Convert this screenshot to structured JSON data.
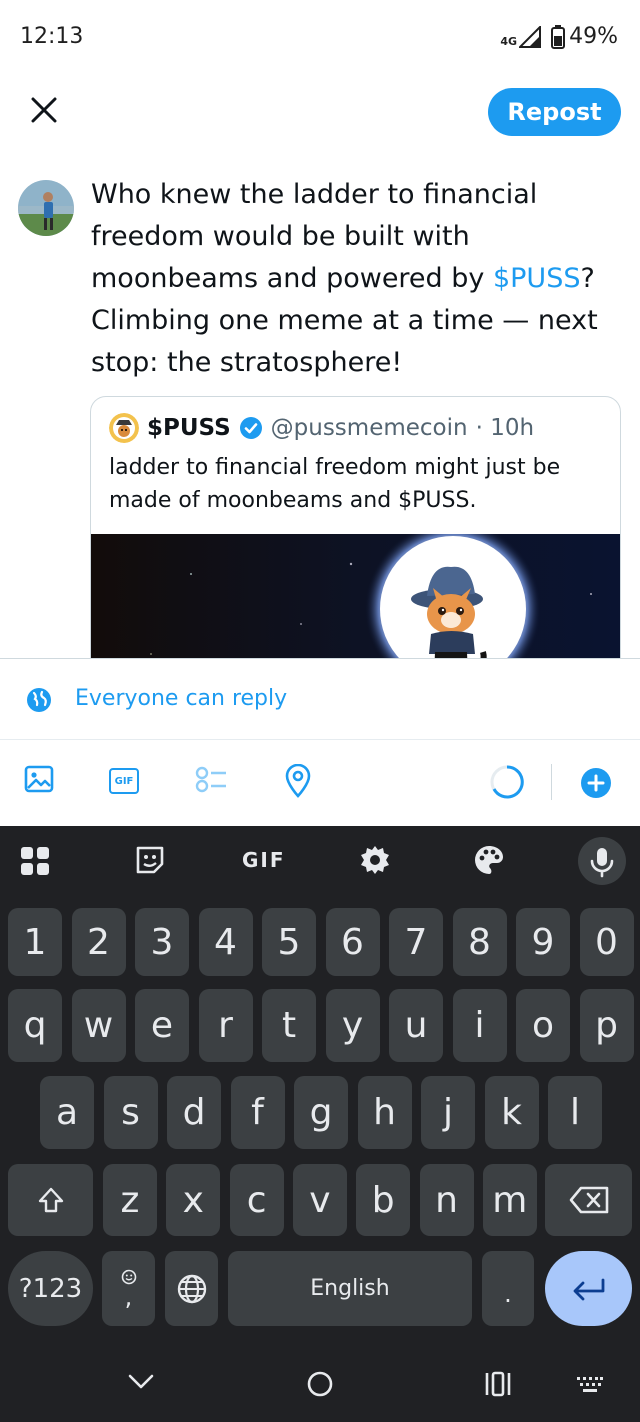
{
  "status_bar": {
    "time": "12:13",
    "network": "4G",
    "battery": "49%"
  },
  "header": {
    "close_icon": "close-icon",
    "repost_label": "Repost"
  },
  "compose": {
    "text_before": "Who knew the ladder to financial freedom would be built with moonbeams and powered by ",
    "cashtag": "$PUSS",
    "text_after": "? Climbing one meme at a time — next stop: the stratosphere!"
  },
  "quote": {
    "name": "$PUSS",
    "handle": "@pussmemecoin",
    "time": "· 10h",
    "text": "ladder to financial freedom might just be made of moonbeams and $PUSS."
  },
  "reply_setting": {
    "label": "Everyone can reply"
  },
  "toolbar": {
    "icons": [
      "image-icon",
      "gif-icon",
      "poll-icon",
      "location-icon",
      "char-count-ring",
      "add-thread-icon"
    ],
    "gif_label": "GIF"
  },
  "keyboard": {
    "top_icons": [
      "apps-grid-icon",
      "sticker-icon",
      "gif-icon",
      "settings-icon",
      "palette-icon",
      "mic-icon"
    ],
    "gif_label": "GIF",
    "row_numbers": [
      "1",
      "2",
      "3",
      "4",
      "5",
      "6",
      "7",
      "8",
      "9",
      "0"
    ],
    "row1": [
      "q",
      "w",
      "e",
      "r",
      "t",
      "y",
      "u",
      "i",
      "o",
      "p"
    ],
    "row2": [
      "a",
      "s",
      "d",
      "f",
      "g",
      "h",
      "j",
      "k",
      "l"
    ],
    "row3": [
      "z",
      "x",
      "c",
      "v",
      "b",
      "n",
      "m"
    ],
    "symbols_label": "?123",
    "comma_label": ",",
    "space_label": "English",
    "period_label": ".",
    "accent_color": "#a8c7fa"
  },
  "colors": {
    "brand": "#1d9bf0",
    "text": "#0f1419",
    "muted": "#536471",
    "keyboard_bg": "#202124",
    "key_bg": "#3c4043"
  }
}
